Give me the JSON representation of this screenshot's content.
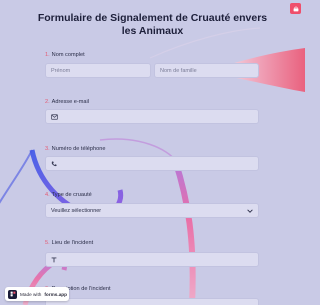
{
  "form": {
    "title": "Formulaire de Signalement de Cruauté envers les Animaux",
    "fields": [
      {
        "num": "1.",
        "label": "Nom complet",
        "first_placeholder": "Prénom",
        "last_placeholder": "Nom de famille"
      },
      {
        "num": "2.",
        "label": "Adresse e-mail",
        "icon": "mail-icon"
      },
      {
        "num": "3.",
        "label": "Numéro de téléphone",
        "icon": "phone-icon"
      },
      {
        "num": "4.",
        "label": "Type de cruauté",
        "value": "Veuillez sélectionner",
        "icon": "chevron-down-icon"
      },
      {
        "num": "5.",
        "label": "Lieu de l'incident",
        "icon": "text-icon"
      },
      {
        "num": "6.",
        "label": "Description de l'incident"
      }
    ]
  },
  "badge": {
    "prefix": "Made with",
    "brand": "forms.app"
  },
  "colors": {
    "background": "#c9cae6",
    "accent": "#ef4f6c",
    "number": "#e45a73"
  }
}
